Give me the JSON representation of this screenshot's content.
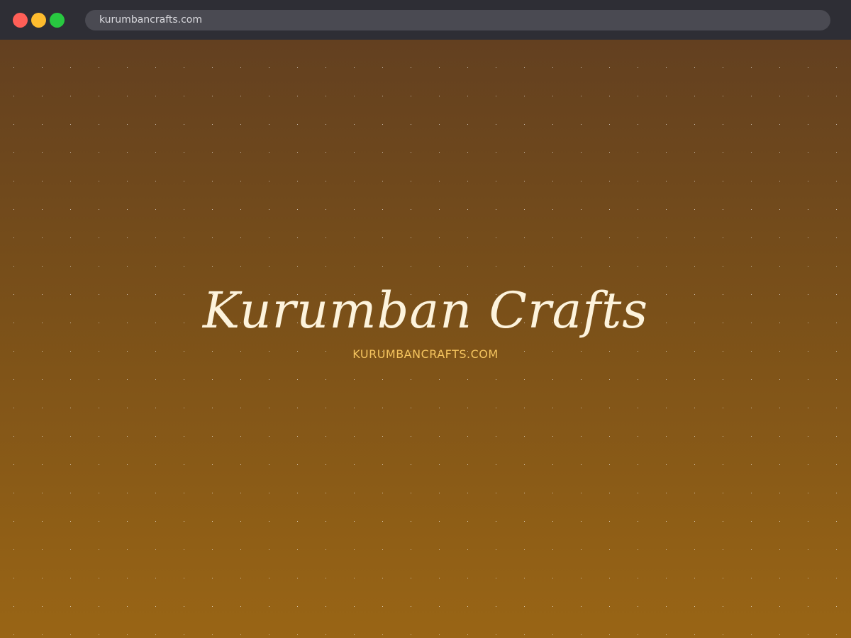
{
  "browser": {
    "url": "kurumbancrafts.com",
    "traffic_lights": {
      "close_color": "#ff5f57",
      "minimize_color": "#febc2e",
      "zoom_color": "#28c840"
    }
  },
  "page": {
    "title": "Kurumban Crafts",
    "domain_label": "KURUMBANCRAFTS.COM",
    "colors": {
      "background_top": "#634020",
      "background_bottom": "#996515",
      "title_color": "#fdf3dc",
      "domain_color": "#f5c45e",
      "dot_color": "#ffffff"
    }
  }
}
